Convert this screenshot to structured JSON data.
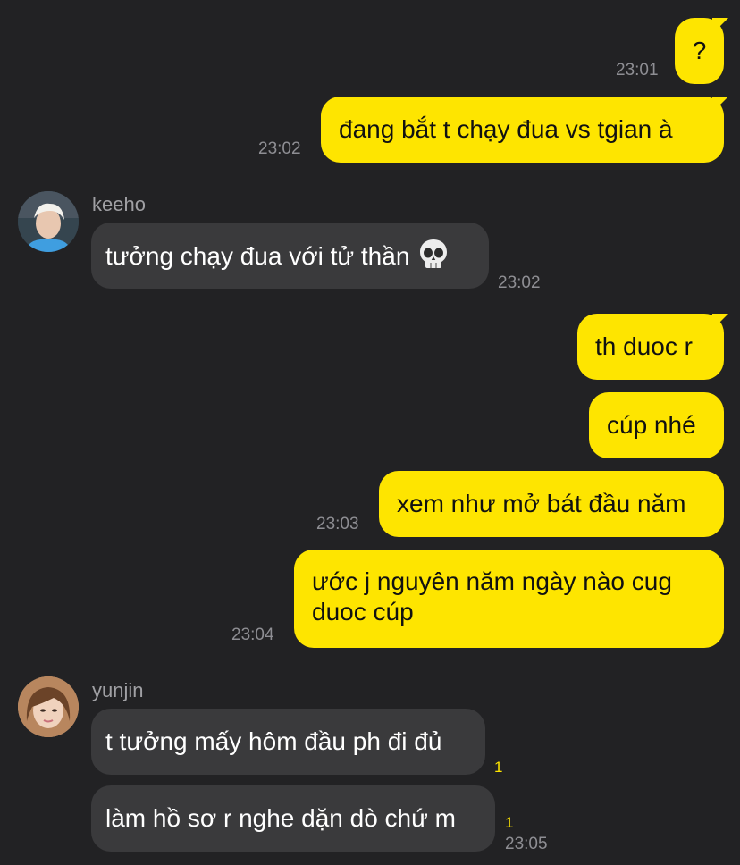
{
  "colors": {
    "background": "#222224",
    "outgoing_bubble": "#FEE500",
    "incoming_bubble": "#3A3A3C",
    "timestamp": "#8E8E93",
    "unread_count": "#FEE500"
  },
  "messages": [
    {
      "direction": "out",
      "text": "?",
      "time": "23:01"
    },
    {
      "direction": "out",
      "text": "đang bắt t chạy đua vs tgian à",
      "time": "23:02"
    },
    {
      "direction": "in",
      "sender": "keeho",
      "avatar": "avatar-keeho",
      "text": "tưởng chạy đua với tử thần",
      "emoji": "skull-icon",
      "time": "23:02"
    },
    {
      "direction": "out",
      "text": "th duoc r"
    },
    {
      "direction": "out",
      "text": "cúp nhé"
    },
    {
      "direction": "out",
      "text": "xem như mở bát đầu năm",
      "time": "23:03"
    },
    {
      "direction": "out",
      "text": "ước j nguyên năm ngày nào cug duoc cúp",
      "time": "23:04"
    },
    {
      "direction": "in",
      "sender": "yunjin",
      "avatar": "avatar-yunjin",
      "text": "t tưởng mấy hôm đầu ph đi đủ",
      "unread": "1"
    },
    {
      "direction": "in",
      "text": "làm hồ sơ r nghe dặn dò chứ m",
      "unread": "1",
      "time": "23:05"
    }
  ]
}
